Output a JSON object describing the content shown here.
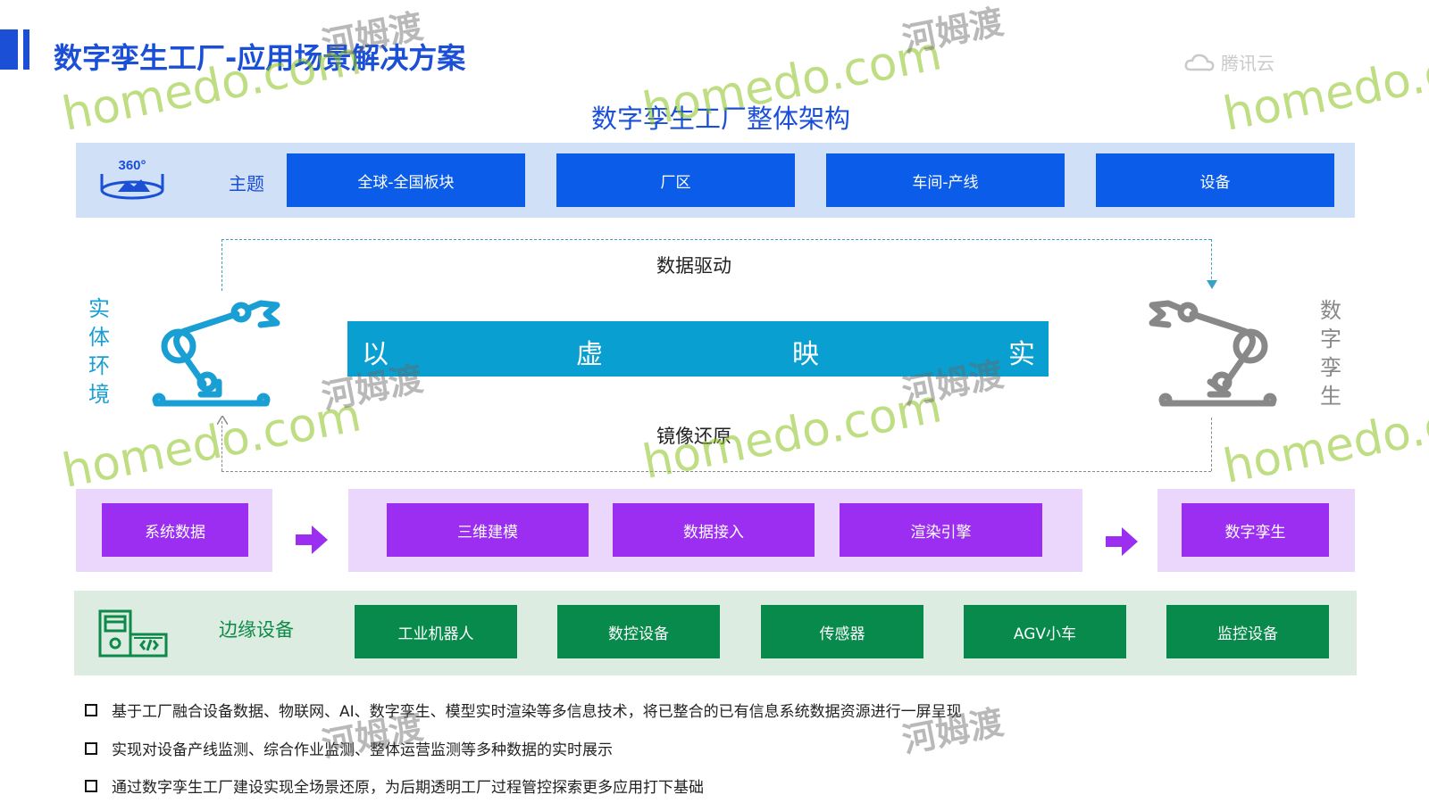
{
  "header": {
    "title": "数字孪生工厂-应用场景解决方案",
    "brand": "腾讯云"
  },
  "diagram": {
    "subtitle": "数字孪生工厂整体架构",
    "theme_row": {
      "icon_text": "360°",
      "label": "主题",
      "items": [
        "全球-全国板块",
        "厂区",
        "车间-产线",
        "设备"
      ]
    },
    "flow": {
      "top_label": "数据驱动",
      "bottom_label": "镜像还原",
      "left_vertical": [
        "实",
        "体",
        "环",
        "境"
      ],
      "right_vertical": [
        "数",
        "字",
        "孪",
        "生"
      ],
      "banner": [
        "以",
        "虚",
        "映",
        "实"
      ]
    },
    "process_row": {
      "source": "系统数据",
      "steps": [
        "三维建模",
        "数据接入",
        "渲染引擎"
      ],
      "result": "数字孪生"
    },
    "edge_row": {
      "label": "边缘设备",
      "items": [
        "工业机器人",
        "数控设备",
        "传感器",
        "AGV小车",
        "监控设备"
      ]
    },
    "colors": {
      "theme_blue": "#0b5ce8",
      "banner_cyan": "#0a9fd1",
      "process_purple": "#9b2ef0",
      "edge_green": "#078a4b"
    }
  },
  "bullets": [
    "基于工厂融合设备数据、物联网、AI、数字孪生、模型实时渲染等多信息技术，将已整合的已有信息系统数据资源进行一屏呈现",
    "实现对设备产线监测、综合作业监测、整体运营监测等多种数据的实时展示",
    "通过数字孪生工厂建设实现全场景还原，为后期透明工厂过程管控探索更多应用打下基础"
  ],
  "watermark": {
    "latin": "homedo.com",
    "cjk": "河姆渡"
  }
}
